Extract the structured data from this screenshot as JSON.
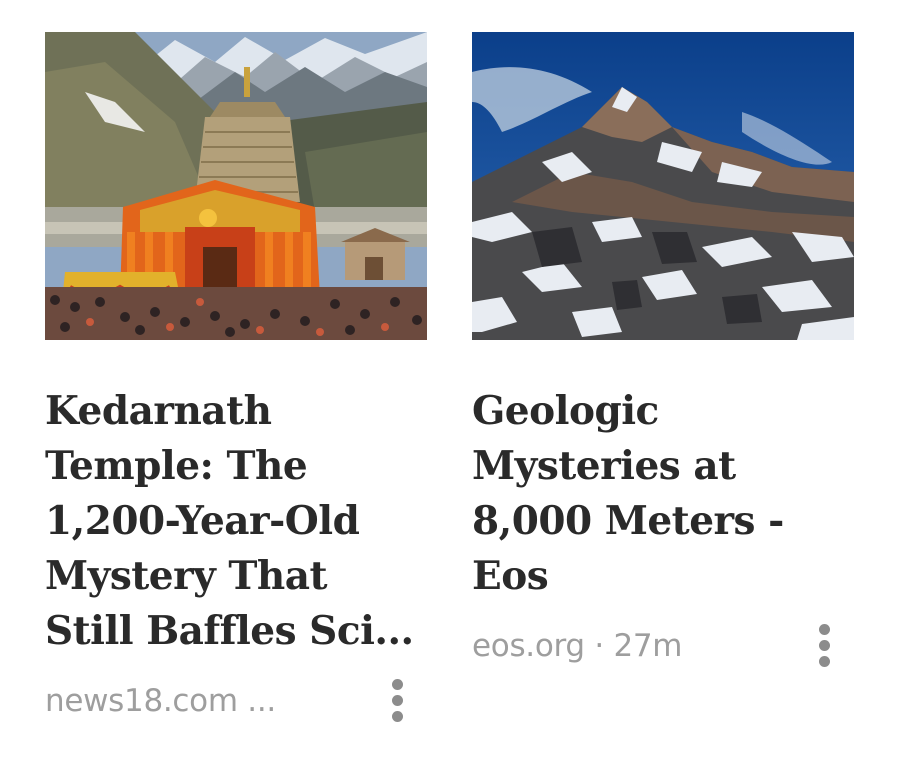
{
  "cards": [
    {
      "title": "Kedarnath Temple: The 1,200-Year-Old Mystery That Still Baffles Sci...",
      "source": "news18.com ...",
      "image_icon": "temple-photo",
      "more_icon": "more-vertical-icon"
    },
    {
      "title": "Geologic Mysteries at 8,000 Meters - Eos",
      "source": "eos.org · 27m",
      "image_icon": "mountain-photo",
      "more_icon": "more-vertical-icon"
    }
  ],
  "colors": {
    "title": "#2a2a2a",
    "source": "#9e9e9e",
    "more_dots": "#8c8c8c"
  }
}
